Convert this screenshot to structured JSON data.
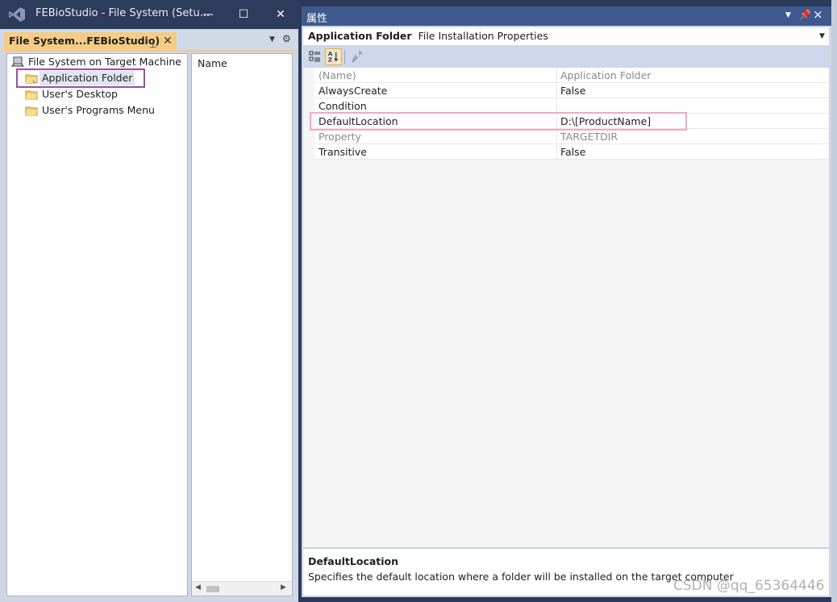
{
  "left_window": {
    "title": "FEBioStudio - File System (Setu...",
    "doc_tab": "File System...FEBioStudio)",
    "tree": {
      "root": "File System on Target Machine",
      "items": [
        "Application Folder",
        "User's Desktop",
        "User's Programs Menu"
      ]
    },
    "list_header": "Name"
  },
  "properties": {
    "title": "属性",
    "object_name": "Application Folder",
    "object_type": "File Installation Properties",
    "rows": [
      {
        "name": "(Name)",
        "value": "Application Folder"
      },
      {
        "name": "AlwaysCreate",
        "value": "False"
      },
      {
        "name": "Condition",
        "value": ""
      },
      {
        "name": "DefaultLocation",
        "value": "D:\\[ProductName]"
      },
      {
        "name": "Property",
        "value": "TARGETDIR"
      },
      {
        "name": "Transitive",
        "value": "False"
      }
    ],
    "description": {
      "title": "DefaultLocation",
      "text": "Specifies the default location where a folder will be installed on the target computer"
    }
  },
  "watermark": "CSDN @qq_65364446",
  "colors": {
    "title_bar": "#2d3b5d",
    "tab_active": "#f5cc84",
    "props_title_bar": "#3e5a8c",
    "highlight_tree": "#9b4da0",
    "highlight_row": "#f0a8c8"
  }
}
